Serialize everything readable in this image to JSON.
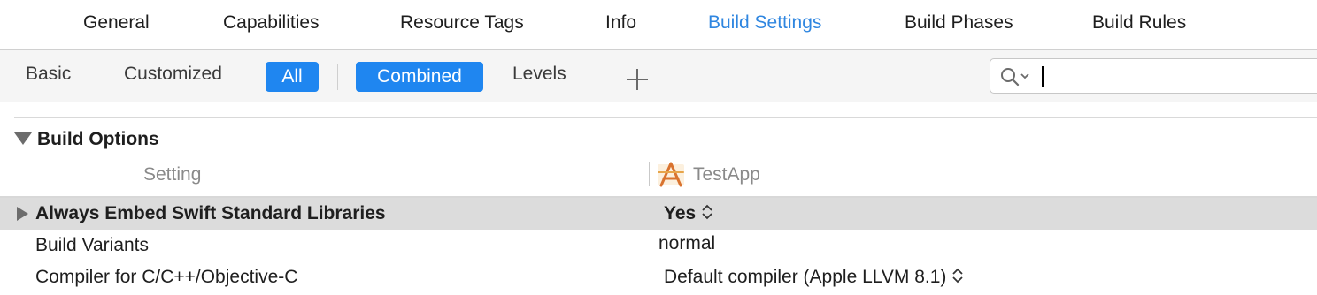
{
  "tabs": [
    {
      "label": "General"
    },
    {
      "label": "Capabilities"
    },
    {
      "label": "Resource Tags"
    },
    {
      "label": "Info"
    },
    {
      "label": "Build Settings"
    },
    {
      "label": "Build Phases"
    },
    {
      "label": "Build Rules"
    }
  ],
  "active_tab": "Build Settings",
  "filter_bar": {
    "basic": "Basic",
    "customized": "Customized",
    "all": "All",
    "combined": "Combined",
    "levels": "Levels",
    "search_value": ""
  },
  "section": {
    "title": "Build Options",
    "column_setting": "Setting",
    "column_target": "TestApp"
  },
  "rows": [
    {
      "label": "Always Embed Swift Standard Libraries",
      "value": "Yes",
      "selected": true
    },
    {
      "label": "Build Variants",
      "value": "normal"
    },
    {
      "label": "Compiler for C/C++/Objective-C",
      "value": "Default compiler (Apple LLVM 8.1)"
    }
  ],
  "colors": {
    "accent": "#1f86f0",
    "active_tab_text": "#2f86e0",
    "selected_row": "#dcdcdc"
  },
  "icons": [
    "search-icon",
    "plus-icon",
    "app-icon",
    "disclosure-triangle-icon",
    "stepper-icon"
  ]
}
